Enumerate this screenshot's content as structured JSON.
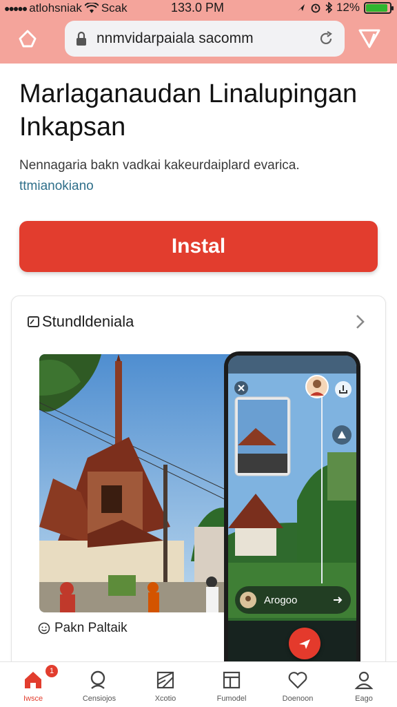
{
  "status_bar": {
    "carrier": "atlohsniak",
    "network": "Scak",
    "time": "133.0 PM",
    "battery": "12%",
    "battery_level": 0.92
  },
  "browser": {
    "url": "nnmvidarpaiala sacomm",
    "home_icon": "home-icon",
    "lock_icon": "lock-icon",
    "reload_icon": "reload-icon",
    "menu_icon": "triangle-menu-icon"
  },
  "page": {
    "title": "Marlaganaudan Linalupingan Inkapsan",
    "description": "Nennagaria bakn vadkai kakeurdaiplard evarica.",
    "description_link": "ttmianokiano",
    "install_label": "Instal"
  },
  "card": {
    "title": "Stundldeniala",
    "photo_caption": "Pakn Paltaik",
    "phone_chip_label": "Arogoo"
  },
  "tabbar": {
    "items": [
      {
        "label": "Iwsce",
        "icon": "home-icon",
        "active": true,
        "badge": "1"
      },
      {
        "label": "Censiojos",
        "icon": "search-icon",
        "active": false
      },
      {
        "label": "Xcotio",
        "icon": "map-icon",
        "active": false
      },
      {
        "label": "Fumodel",
        "icon": "layout-icon",
        "active": false
      },
      {
        "label": "Doenoon",
        "icon": "heart-icon",
        "active": false
      },
      {
        "label": "Eago",
        "icon": "person-icon",
        "active": false
      }
    ]
  },
  "colors": {
    "chrome": "#f4a49b",
    "accent": "#e23d2e",
    "link": "#2f6f8a"
  }
}
